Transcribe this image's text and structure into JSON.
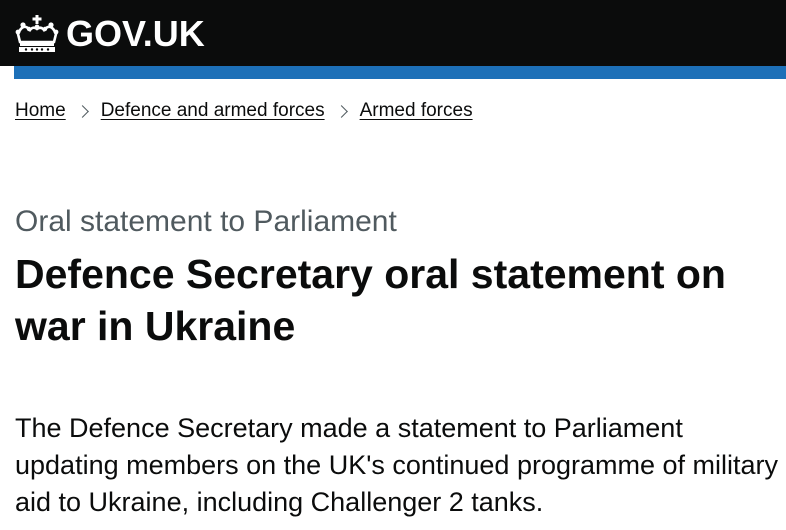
{
  "header": {
    "logo_text": "GOV.UK",
    "logo_icon": "crown-icon",
    "background": "#0b0c0c",
    "accent_bar": "#1d70b8"
  },
  "breadcrumbs": [
    {
      "label": "Home"
    },
    {
      "label": "Defence and armed forces"
    },
    {
      "label": "Armed forces"
    }
  ],
  "page": {
    "caption": "Oral statement to Parliament",
    "title": "Defence Secretary oral statement on war in Ukraine",
    "lead": "The Defence Secretary made a statement to Parliament updating members on the UK's continued programme of military aid to Ukraine, including Challenger 2 tanks."
  }
}
